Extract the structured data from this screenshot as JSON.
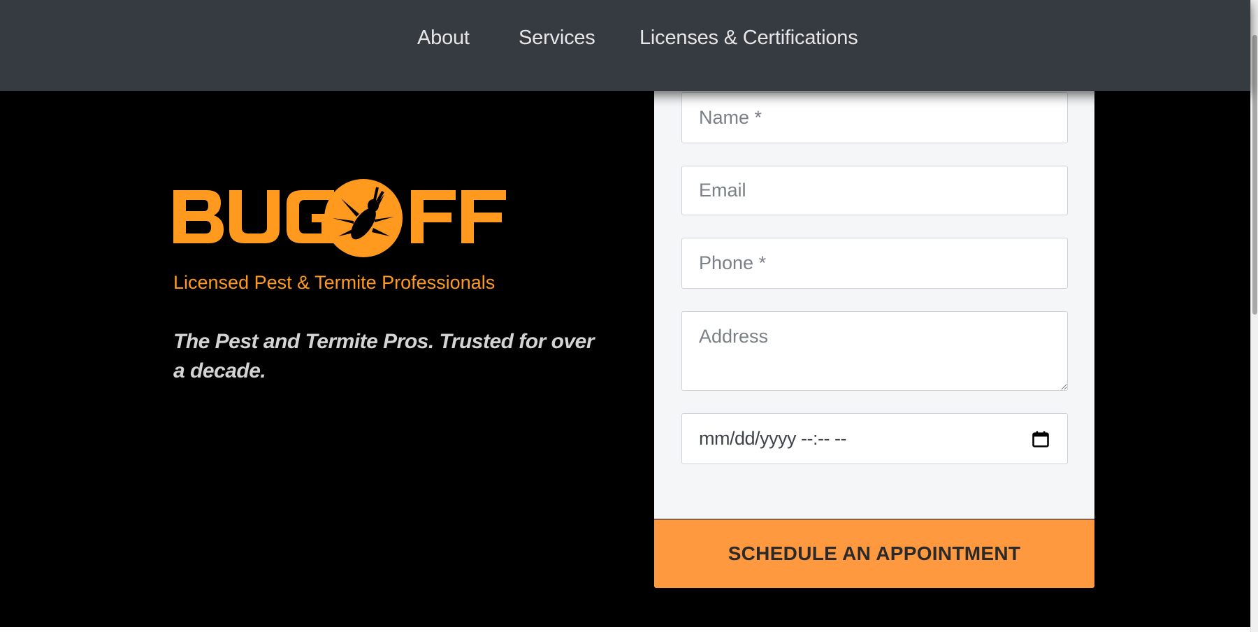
{
  "nav": {
    "items": [
      {
        "label": "About"
      },
      {
        "label": "Services"
      },
      {
        "label": "Licenses & Certifications"
      }
    ]
  },
  "brand": {
    "logo_text": "BUGOFF",
    "tagline": "Licensed Pest & Termite Professionals",
    "headline": "The Pest and Termite Pros. Trusted for over a decade.",
    "accent_color": "#FF9A1F"
  },
  "form": {
    "name_placeholder": "Name *",
    "email_placeholder": "Email",
    "phone_placeholder": "Phone *",
    "address_placeholder": "Address",
    "datetime_placeholder": "mm/dd/yyyy --:-- --",
    "submit_label": "SCHEDULE AN APPOINTMENT",
    "submit_color": "#FF9940"
  },
  "icons": {
    "calendar": "calendar-icon",
    "logo_bug": "bug-icon"
  }
}
